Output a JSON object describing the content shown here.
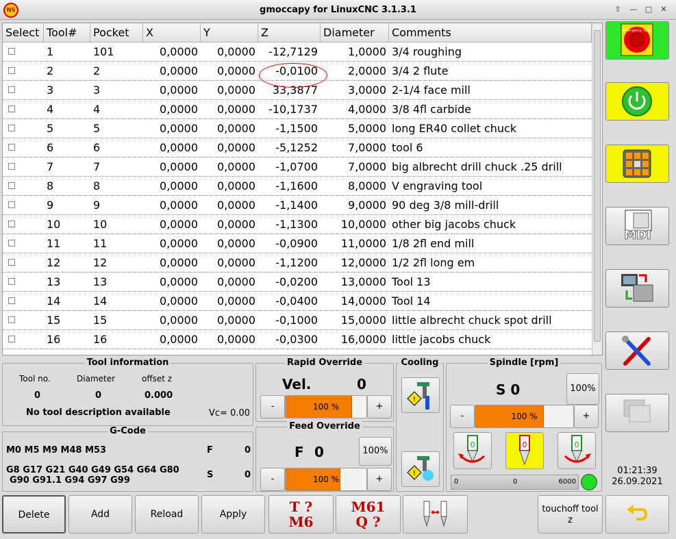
{
  "window": {
    "title": "gmoccapy for LinuxCNC  3.1.3.1",
    "logo_text": "NS",
    "controls": [
      "⇧",
      "—",
      "□",
      "✕"
    ]
  },
  "table": {
    "headers": [
      "Select",
      "Tool#",
      "Pocket",
      "X",
      "Y",
      "Z",
      "Diameter",
      "Comments"
    ],
    "rows": [
      [
        "1",
        "101",
        "0,0000",
        "0,0000",
        "-12,7129",
        "1,0000",
        "3/4 roughing"
      ],
      [
        "2",
        "2",
        "0,0000",
        "0,0000",
        "-0,0100",
        "2,0000",
        "3/4 2 flute"
      ],
      [
        "3",
        "3",
        "0,0000",
        "0,0000",
        "33,3877",
        "3,0000",
        "2-1/4 face mill"
      ],
      [
        "4",
        "4",
        "0,0000",
        "0,0000",
        "-10,1737",
        "4,0000",
        "3/8 4fl carbide"
      ],
      [
        "5",
        "5",
        "0,0000",
        "0,0000",
        "-1,1500",
        "5,0000",
        "long ER40 collet chuck"
      ],
      [
        "6",
        "6",
        "0,0000",
        "0,0000",
        "-5,1252",
        "7,0000",
        "tool 6"
      ],
      [
        "7",
        "7",
        "0,0000",
        "0,0000",
        "-1,0700",
        "7,0000",
        "big albrecht drill chuck .25 drill"
      ],
      [
        "8",
        "8",
        "0,0000",
        "0,0000",
        "-1,1600",
        "8,0000",
        "V engraving tool"
      ],
      [
        "9",
        "9",
        "0,0000",
        "0,0000",
        "-1,1400",
        "9,0000",
        "90 deg 3/8 mill-drill"
      ],
      [
        "10",
        "10",
        "0,0000",
        "0,0000",
        "-1,1300",
        "10,0000",
        "other big jacobs chuck"
      ],
      [
        "11",
        "11",
        "0,0000",
        "0,0000",
        "-0,0900",
        "11,0000",
        "1/8 2fl end mill"
      ],
      [
        "12",
        "12",
        "0,0000",
        "0,0000",
        "-1,1200",
        "12,0000",
        "1/2 2fl long em"
      ],
      [
        "13",
        "13",
        "0,0000",
        "0,0000",
        "-0,0200",
        "13,0000",
        "Tool 13"
      ],
      [
        "14",
        "14",
        "0,0000",
        "0,0000",
        "-0,0400",
        "14,0000",
        "Tool 14"
      ],
      [
        "15",
        "15",
        "0,0000",
        "0,0000",
        "-0,1000",
        "15,0000",
        "little albrecht chuck spot drill"
      ],
      [
        "16",
        "16",
        "0,0000",
        "0,0000",
        "-0,0300",
        "16,0000",
        "little jacobs chuck"
      ]
    ]
  },
  "tool_info": {
    "title": "Tool information",
    "tool_no_label": "Tool no.",
    "diameter_label": "Diameter",
    "offset_label": "offset z",
    "tool_no": "0",
    "diameter": "0",
    "offset": "0.000",
    "description": "No tool description available",
    "vc": "Vc= 0.00"
  },
  "gcode": {
    "title": "G-Code",
    "line1": "M0 M5 M9 M48 M53",
    "line2": "G8 G17 G21 G40 G49 G54 G64 G80",
    "line3": "G90 G91.1 G94 G97 G99",
    "f_label": "F",
    "f_value": "0",
    "s_label": "S",
    "s_value": "0"
  },
  "rapid": {
    "title": "Rapid Override",
    "vel_label": "Vel.",
    "vel_value": "0",
    "minus": "-",
    "plus": "+",
    "percent_text": "100 %",
    "fraction": 0.82
  },
  "feed": {
    "title": "Feed Override",
    "f_label": "F",
    "f_value": "0",
    "reset": "100%",
    "minus": "-",
    "plus": "+",
    "percent_text": "100 %",
    "fraction": 0.68
  },
  "cooling": {
    "title": "Cooling"
  },
  "spindle": {
    "title": "Spindle [rpm]",
    "s_text": "S 0",
    "reset": "100%",
    "minus": "-",
    "plus": "+",
    "percent_text": "100 %",
    "fraction": 0.7,
    "bar_min": "0",
    "bar_value": "0",
    "bar_max": "6000",
    "forward_label": "0",
    "stop_label": "0",
    "reverse_label": "0"
  },
  "clock": {
    "time": "01:21:39",
    "date": "26.09.2021"
  },
  "bottom": {
    "delete": "Delete",
    "add": "Add",
    "reload": "Reload",
    "apply": "Apply",
    "t_line1": "T ?",
    "t_line2": "M6",
    "m_line1": "M61",
    "m_line2": "Q ?",
    "touchoff": "touchoff tool z"
  },
  "side": {
    "mdi_label": "MDI",
    "estop_text": "Emergency Stop"
  },
  "colors": {
    "active_green": "#2ee62e",
    "active_yellow": "#f5f500",
    "orange": "#f57c00",
    "led_green": "#22dd22"
  }
}
